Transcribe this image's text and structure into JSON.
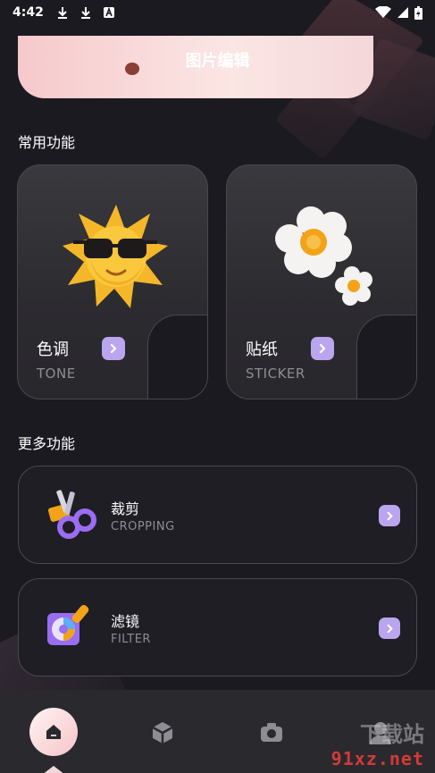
{
  "status_bar": {
    "time": "4:42",
    "left_icons": [
      "download-icon",
      "download-icon",
      "a-notification-icon"
    ],
    "right_icons": [
      "wifi-icon",
      "signal-icon",
      "battery-icon"
    ]
  },
  "header": {
    "title": "图片编辑"
  },
  "sections": {
    "common": "常用功能",
    "more": "更多功能"
  },
  "feature_cards": [
    {
      "label": "色调",
      "sub": "TONE",
      "icon": "sun-sunglasses-icon"
    },
    {
      "label": "贴纸",
      "sub": "STICKER",
      "icon": "flower-sticker-icon"
    }
  ],
  "list_cards": [
    {
      "title": "裁剪",
      "sub": "CROPPING",
      "icon": "scissors-icon"
    },
    {
      "title": "滤镜",
      "sub": "FILTER",
      "icon": "filter-lens-icon"
    }
  ],
  "bottom_nav": {
    "items": [
      "home-icon",
      "cube-icon",
      "camera-icon",
      "profile-icon"
    ],
    "active": "home-icon"
  },
  "watermark": {
    "text": "91xz.net",
    "top": "下载站"
  },
  "colors": {
    "background": "#1b1a20",
    "accent": "#b9a6ee",
    "banner": "#f6c9cc",
    "nav_background": "#2a292e"
  }
}
